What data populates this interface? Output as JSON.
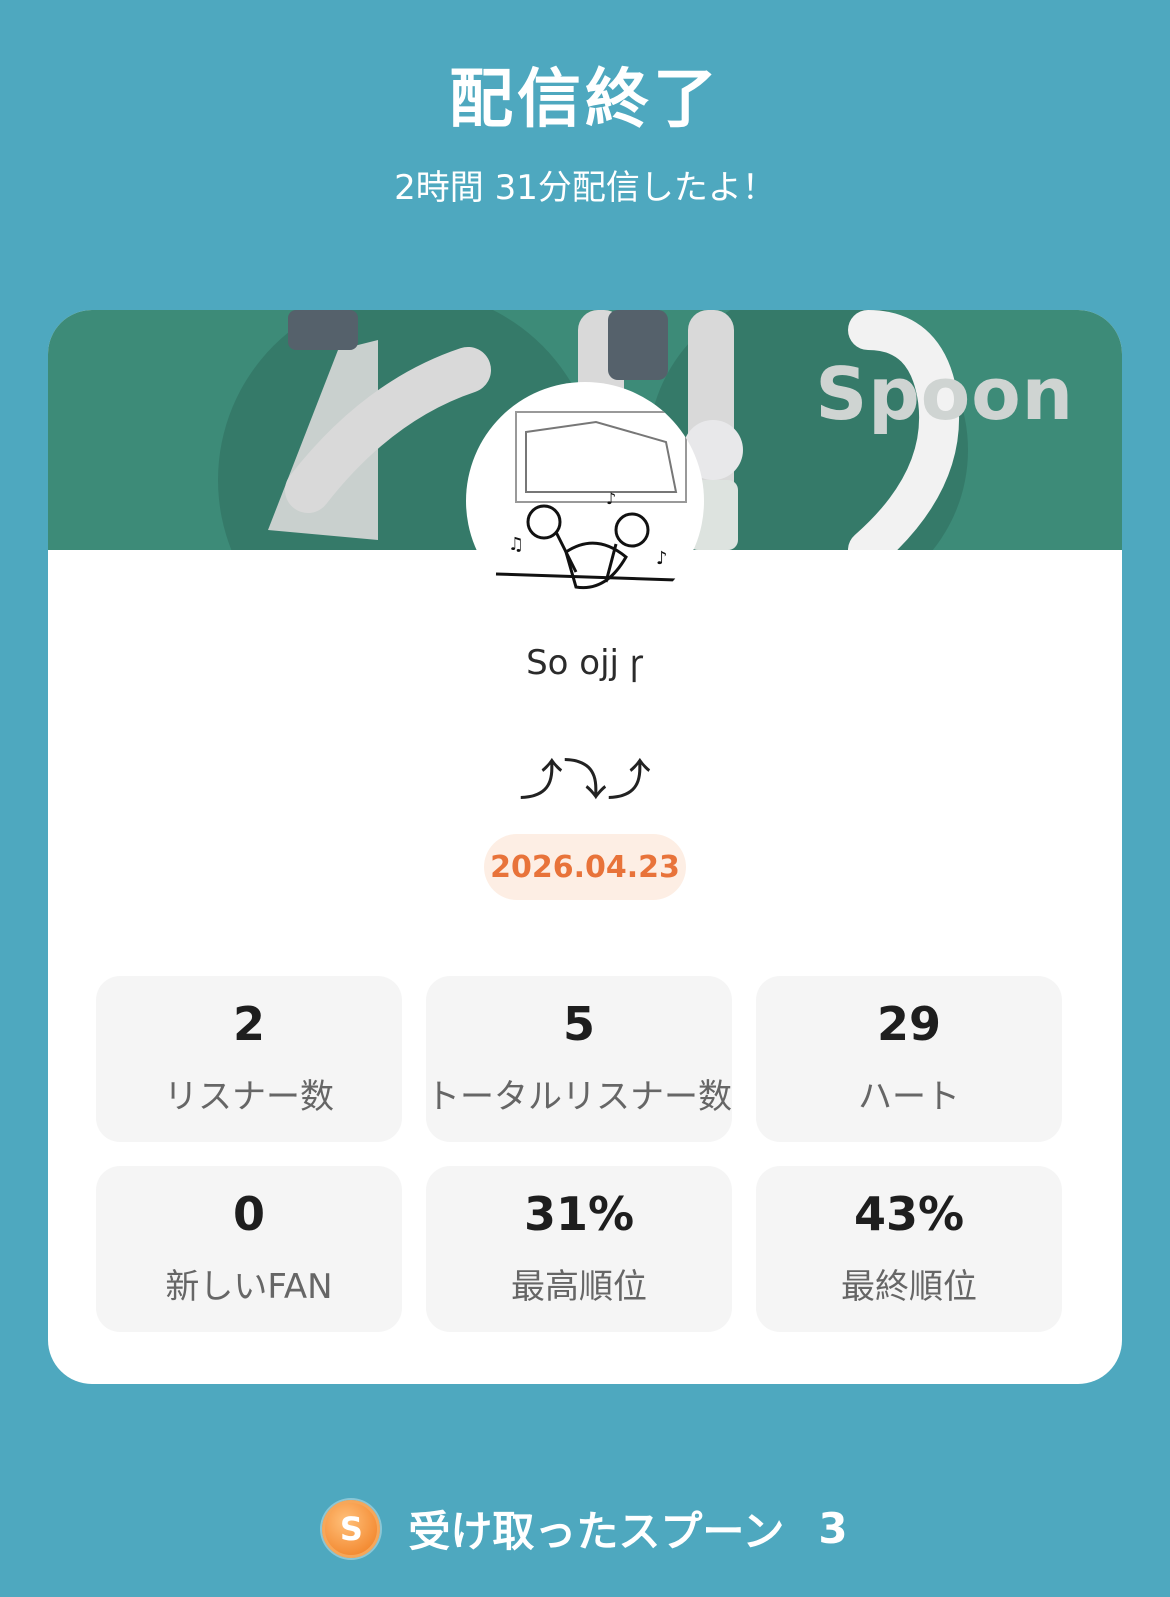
{
  "header": {
    "title": "配信終了",
    "subtitle": "2時間 31分配信したよ！"
  },
  "banner": {
    "brand": "Spoon"
  },
  "profile": {
    "username": "So ojj ꞅ",
    "tagline": "⤴⤵⤴",
    "date": "2026.04.23"
  },
  "stats": [
    {
      "value": "2",
      "label": "リスナー数"
    },
    {
      "value": "5",
      "label": "トータルリスナー数"
    },
    {
      "value": "29",
      "label": "ハート"
    },
    {
      "value": "0",
      "label": "新しいFAN"
    },
    {
      "value": "31%",
      "label": "最高順位"
    },
    {
      "value": "43%",
      "label": "最終順位"
    }
  ],
  "spoons": {
    "coin_letter": "S",
    "label": "受け取ったスプーン",
    "count": "3"
  },
  "colors": {
    "background": "#4ea8bf",
    "banner": "#3d8b78",
    "date_text": "#e8733a",
    "date_bg": "#fdeee4"
  }
}
